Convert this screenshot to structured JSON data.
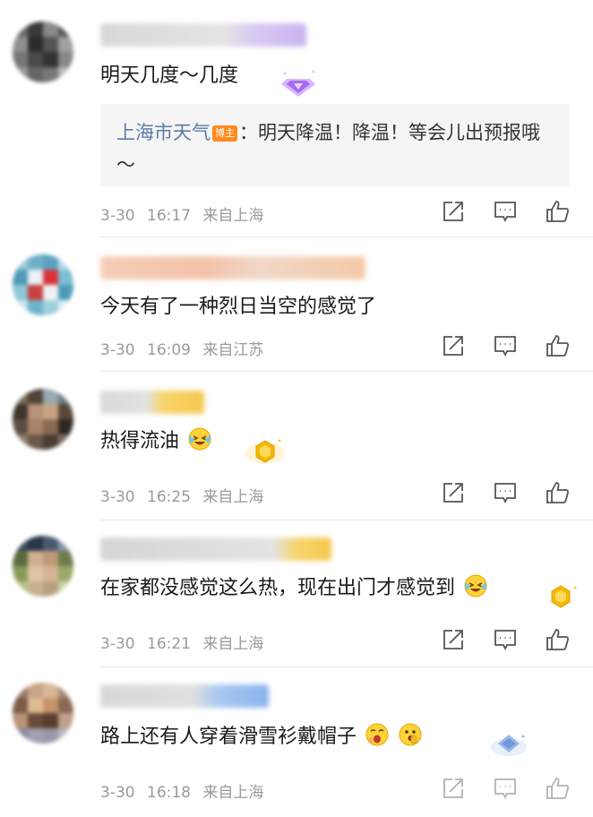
{
  "comments": [
    {
      "content": "明天几度～几度",
      "reply": {
        "author": "上海市天气",
        "badge": "博主",
        "text": "：明天降温！降温！等会儿出预报哦～"
      },
      "date": "3-30",
      "time": "16:17",
      "location": "来自上海"
    },
    {
      "content": "今天有了一种烈日当空的感觉了",
      "date": "3-30",
      "time": "16:09",
      "location": "来自江苏"
    },
    {
      "content": "热得流油",
      "date": "3-30",
      "time": "16:25",
      "location": "来自上海"
    },
    {
      "content": "在家都没感觉这么热，现在出门才感觉到",
      "date": "3-30",
      "time": "16:21",
      "location": "来自上海"
    },
    {
      "content": "路上还有人穿着滑雪衫戴帽子",
      "date": "3-30",
      "time": "16:18",
      "location": "来自上海"
    }
  ],
  "actions": {
    "share_icon": "share-icon",
    "reply_icon": "comment-icon",
    "like_icon": "thumbs-up-icon"
  },
  "colors": {
    "reply_author": "#5b7ca8",
    "badge": "#ff8a1d",
    "meta_text": "#9a9a9a"
  }
}
